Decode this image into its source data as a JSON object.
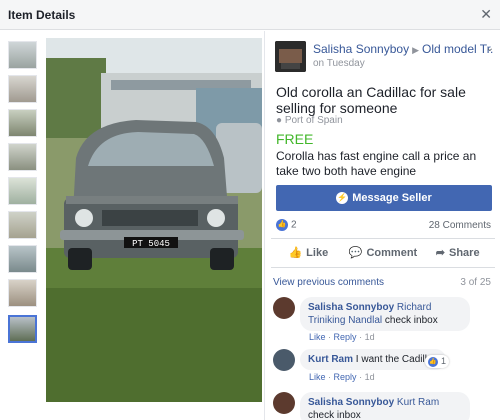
{
  "dialog": {
    "title": "Item Details",
    "close_icon": "✕"
  },
  "thumbnails": {
    "count": 9,
    "selected_index": 9
  },
  "seller": {
    "name": "Salisha Sonnyboy",
    "group": "Old model Tr...",
    "posted": "on Tuesday"
  },
  "listing": {
    "title": "Old corolla an Cadillac for sale selling for someone",
    "location": "Port of Spain",
    "price": "FREE",
    "description": "Corolla has fast engine call a price an take two both have engine",
    "plate": "PT 5045"
  },
  "message_button": {
    "label": "Message Seller"
  },
  "stats": {
    "likes": "2",
    "comments": "28 Comments"
  },
  "actions": {
    "like": "Like",
    "comment": "Comment",
    "share": "Share"
  },
  "comments_section": {
    "view_previous": "View previous comments",
    "count": "3 of 25",
    "items": [
      {
        "author": "Salisha Sonnyboy",
        "tag": "Richard Triniking Nandlal",
        "text": "check inbox",
        "like": "Like",
        "reply": "Reply",
        "time": "1d"
      },
      {
        "author": "Kurt Ram",
        "tag": "",
        "text": "I want the Cadillac",
        "like": "Like",
        "reply": "Reply",
        "time": "1d",
        "reactions": "1"
      },
      {
        "author": "Salisha Sonnyboy",
        "tag": "Kurt Ram",
        "text": "check inbox"
      }
    ]
  },
  "colors": {
    "brand": "#4267b2",
    "link": "#385898",
    "price": "#42b72a"
  }
}
